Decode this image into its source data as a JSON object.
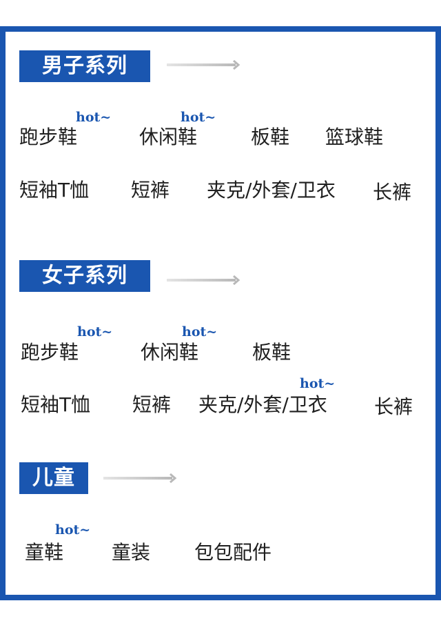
{
  "colors": {
    "accent": "#1a56b0",
    "text": "#1f1f1f",
    "background": "#ffffff"
  },
  "hot_label": "hot~",
  "sections": [
    {
      "title": "男子系列",
      "rows": [
        [
          {
            "label": "跑步鞋",
            "hot": true
          },
          {
            "label": "休闲鞋",
            "hot": true
          },
          {
            "label": "板鞋",
            "hot": false
          },
          {
            "label": "篮球鞋",
            "hot": false
          }
        ],
        [
          {
            "label": "短袖T恤",
            "hot": false
          },
          {
            "label": "短裤",
            "hot": false
          },
          {
            "label": "夹克/外套/卫衣",
            "hot": false
          },
          {
            "label": "长裤",
            "hot": false
          }
        ]
      ]
    },
    {
      "title": "女子系列",
      "rows": [
        [
          {
            "label": "跑步鞋",
            "hot": true
          },
          {
            "label": "休闲鞋",
            "hot": true
          },
          {
            "label": "板鞋",
            "hot": false
          }
        ],
        [
          {
            "label": "短袖T恤",
            "hot": false
          },
          {
            "label": "短裤",
            "hot": false
          },
          {
            "label": "夹克/外套/卫衣",
            "hot": true
          },
          {
            "label": "长裤",
            "hot": false
          }
        ]
      ]
    },
    {
      "title": "儿童",
      "rows": [
        [
          {
            "label": "童鞋",
            "hot": true
          },
          {
            "label": "童装",
            "hot": false
          },
          {
            "label": "包包配件",
            "hot": false
          }
        ]
      ]
    }
  ]
}
